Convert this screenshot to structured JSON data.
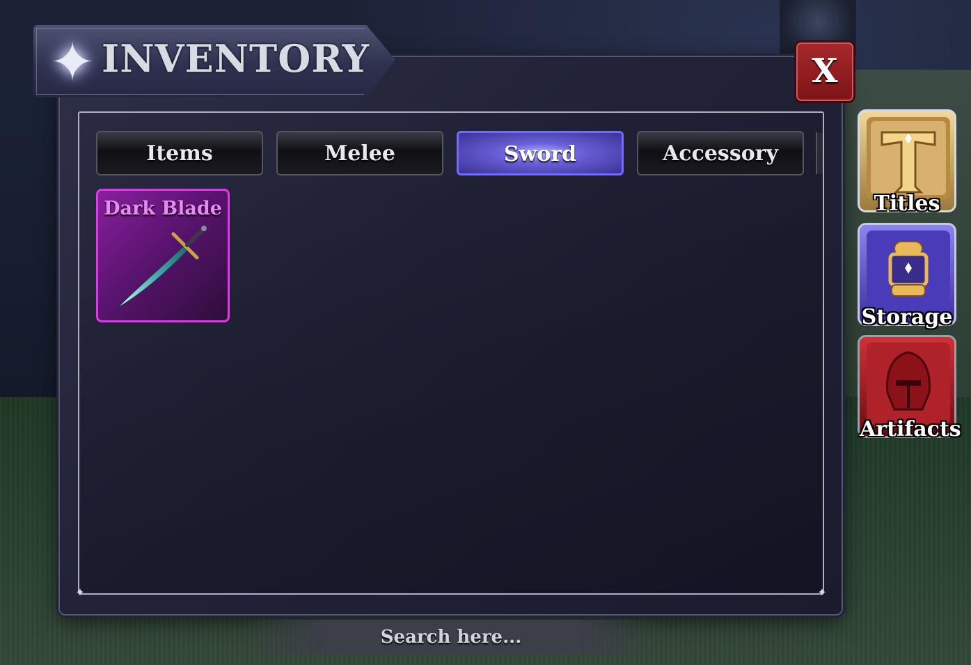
{
  "header": {
    "title": "INVENTORY",
    "close_label": "X"
  },
  "tabs": [
    {
      "label": "Items",
      "active": false
    },
    {
      "label": "Melee",
      "active": false
    },
    {
      "label": "Sword",
      "active": true
    },
    {
      "label": "Accessory",
      "active": false
    }
  ],
  "items": [
    {
      "name": "Dark Blade",
      "rarity_color": "#e03ae8",
      "icon": "sword-icon"
    }
  ],
  "side_menu": [
    {
      "label": "Titles",
      "icon": "title-t-icon",
      "color": "#c89b52"
    },
    {
      "label": "Storage",
      "icon": "storage-capsule-icon",
      "color": "#5a4cc8"
    },
    {
      "label": "Artifacts",
      "icon": "knight-helmet-icon",
      "color": "#b0222a"
    }
  ],
  "search": {
    "placeholder": "Search here..."
  },
  "colors": {
    "panel": "#1f2034",
    "active_tab": "#6a60d8",
    "close": "#a8282c"
  }
}
